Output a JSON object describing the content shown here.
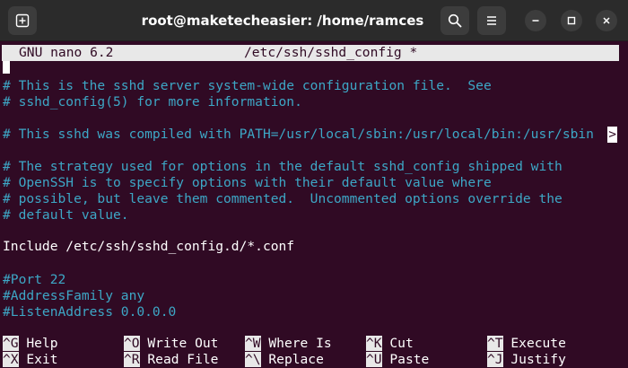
{
  "window": {
    "title": "root@maketecheasier: /home/ramces",
    "new_tab_icon": "new-tab-icon",
    "search_icon": "search-icon",
    "menu_icon": "hamburger-menu-icon",
    "minimize_icon": "minimize-icon",
    "maximize_icon": "maximize-icon",
    "close_icon": "close-icon"
  },
  "nano": {
    "version": "GNU nano 6.2",
    "filename": "/etc/ssh/sshd_config *",
    "overflow_marker": ">"
  },
  "lines": [
    {
      "text": "# This is the sshd server system-wide configuration file.  See",
      "kind": "comment"
    },
    {
      "text": "# sshd_config(5) for more information.",
      "kind": "comment"
    },
    {
      "text": "# This sshd was compiled with PATH=/usr/local/sbin:/usr/local/bin:/usr/sbin",
      "kind": "comment"
    },
    {
      "text": "# The strategy used for options in the default sshd_config shipped with",
      "kind": "comment"
    },
    {
      "text": "# OpenSSH is to specify options with their default value where",
      "kind": "comment"
    },
    {
      "text": "# possible, but leave them commented.  Uncommented options override the",
      "kind": "comment"
    },
    {
      "text": "# default value.",
      "kind": "comment"
    },
    {
      "text": "Include /etc/ssh/sshd_config.d/*.conf",
      "kind": "plain"
    },
    {
      "text": "#Port 22",
      "kind": "comment"
    },
    {
      "text": "#AddressFamily any",
      "kind": "comment"
    },
    {
      "text": "#ListenAddress 0.0.0.0",
      "kind": "comment"
    }
  ],
  "shortcuts": [
    {
      "key": "^G",
      "label": "Help"
    },
    {
      "key": "^O",
      "label": "Write Out"
    },
    {
      "key": "^W",
      "label": "Where Is"
    },
    {
      "key": "^K",
      "label": "Cut"
    },
    {
      "key": "^T",
      "label": "Execute"
    },
    {
      "key": "^X",
      "label": "Exit"
    },
    {
      "key": "^R",
      "label": "Read File"
    },
    {
      "key": "^\\",
      "label": "Replace"
    },
    {
      "key": "^U",
      "label": "Paste"
    },
    {
      "key": "^J",
      "label": "Justify"
    }
  ],
  "colors": {
    "background": "#300a24",
    "comment": "#3da7c6",
    "text": "#ffffff",
    "header_bg": "#e8e8e8",
    "titlebar": "#2b2b2b"
  }
}
